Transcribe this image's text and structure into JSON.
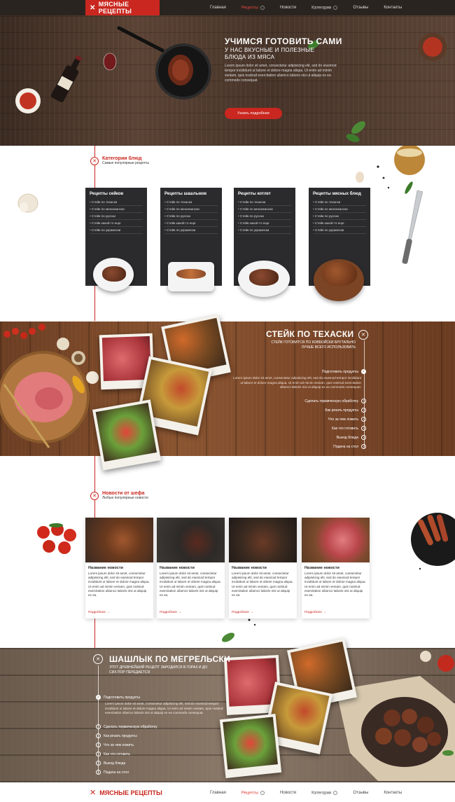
{
  "header": {
    "logo": "МЯСНЫЕ РЕЦЕПТЫ",
    "nav": [
      "Главная",
      "Рецепты",
      "Новости",
      "Категории",
      "Отзывы",
      "Контакты"
    ]
  },
  "hero": {
    "title": "УЧИМСЯ ГОТОВИТЬ САМИ",
    "subtitle_line1": "У НАС ВКУСНЫЕ И ПОЛЕЗНЫЕ",
    "subtitle_line2": "БЛЮДА ИЗ МЯСА",
    "description": "Lorem ipsum dolor sit amet, consectetur adipisicing elit, sed do eiusmod tempor incididunt ut labore et dolore magna aliqua. Ut enim ad minim veniam, quis nostrud exercitation ullamco laboris nisi ut aliquip ex ea commodo consequat.",
    "button": "Узнать подробнее"
  },
  "categories": {
    "title": "Категории блюд",
    "subtitle": "Самые популярные рецепты",
    "cards": [
      {
        "title": "Рецепты сейков",
        "items": [
          "Стейк по техаски",
          "Стейк по мексикански",
          "Стейк по русски",
          "Стейк какой то еще",
          "Стейк по украински"
        ]
      },
      {
        "title": "Рецепты шашлыков",
        "items": [
          "Стейк по техаски",
          "Стейк по мексикански",
          "Стейк по русски",
          "Стейк какой то еще",
          "Стейк по украински"
        ]
      },
      {
        "title": "Рецепты котлет",
        "items": [
          "Стейк по техаски",
          "Стейк по мексикански",
          "Стейк по русски",
          "Стейк какой то еще",
          "Стейк по украински"
        ]
      },
      {
        "title": "Рецепты мясных блюд",
        "items": [
          "Стейк по техаски",
          "Стейк по мексикански",
          "Стейк по русски",
          "Стейк какой то еще",
          "Стейк по украински"
        ]
      }
    ]
  },
  "steak": {
    "title": "СТЕЙК ПО ТЕХАСКИ",
    "subtitle": "СТЕЙК ГОТОВИТСЯ ПО КОВБОЙСКИ БРУТАЛЬНО ЛУЧШЕ ВСЕГО ИСПОЛЬЗОВАТЬ",
    "step_first": "Подготовить продукты",
    "step_text": "Lorem ipsum dolor sit amet, consectetur adipisicing elit, sed do eiusmod tempor incididunt ut labore et dolore magna aliqua. Ut enim ad minim veniam, quis nostrud exercitation ullamco laboris nisi ut aliquip ex ea commodo consequat.",
    "steps": [
      "Сделать термическую обработку",
      "Как резать продукты",
      "Что за чем ложить",
      "Как что готовить",
      "Выход блюда",
      "Подача на стол"
    ]
  },
  "news": {
    "title": "Новости от шефа",
    "subtitle": "Любые популярные новости",
    "items": [
      {
        "title": "Название новости",
        "text": "Lorem ipsum dolor sit amet, consectetur adipisicing elit, sed do eiusmod tempor incididunt ut labore et dolore magna aliqua. Ut enim ad minim veniam, quis nostrud exercitation ullamco laboris nisi ut aliquip ex ea.",
        "more": "Подробнее →"
      },
      {
        "title": "Название новости",
        "text": "Lorem ipsum dolor sit amet, consectetur adipisicing elit, sed do eiusmod tempor incididunt ut labore et dolore magna aliqua. Ut enim ad minim veniam, quis nostrud exercitation ullamco laboris nisi ut aliquip ex ea.",
        "more": "Подробнее →"
      },
      {
        "title": "Название новости",
        "text": "Lorem ipsum dolor sit amet, consectetur adipisicing elit, sed do eiusmod tempor incididunt ut labore et dolore magna aliqua. Ut enim ad minim veniam, quis nostrud exercitation ullamco laboris nisi ut aliquip ex ea.",
        "more": "Подробнее →"
      },
      {
        "title": "Название новости",
        "text": "Lorem ipsum dolor sit amet, consectetur adipisicing elit, sed do eiusmod tempor incididunt ut labore et dolore magna aliqua. Ut enim ad minim veniam, quis nostrud exercitation ullamco laboris nisi ut aliquip ex ea.",
        "more": "Подробнее →"
      }
    ]
  },
  "shashlik": {
    "title": "ШАШЛЫК ПО МЕГРЕЛЬСКИ",
    "subtitle": "ЭТОТ ДРЕВНЕЙШИЙ РЕЦЕПТ ЗАРОДИЛСЯ В ГОРАХ И ДО СИХ ПОР ПЕРЕДАЕТСЯ",
    "step_first": "Подготовить продукты",
    "step_text": "Lorem ipsum dolor sit amet, consectetur adipisicing elit, sed do eiusmod tempor incididunt ut labore et dolore magna aliqua. Ut enim ad minim veniam, quis nostrud exercitation ullamco laboris nisi ut aliquip ex ea commodo consequat.",
    "steps": [
      "Сделать термическую обработку",
      "Как резать продукты",
      "Что за чем ложить",
      "Как что готовить",
      "Выход блюда",
      "Подача на стол"
    ]
  },
  "footer": {
    "logo": "МЯСНЫЕ РЕЦЕПТЫ",
    "nav": [
      "Главная",
      "Рецепты",
      "Новости",
      "Категории",
      "Отзывы",
      "Контакты"
    ]
  },
  "colors": {
    "accent": "#c9271f",
    "dark": "#2a2420"
  }
}
